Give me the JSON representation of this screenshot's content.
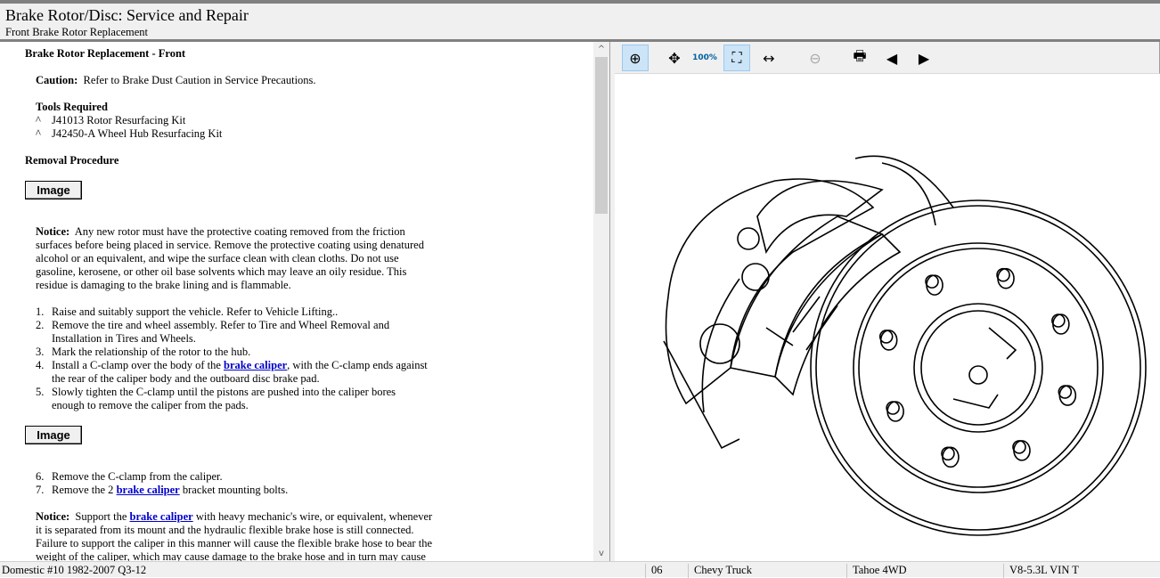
{
  "header": {
    "title": "Brake Rotor/Disc:  Service and Repair",
    "subtitle": "Front Brake Rotor Replacement"
  },
  "doc": {
    "heading": "Brake Rotor Replacement - Front",
    "caution_label": "Caution:",
    "caution_text": "Refer to Brake Dust Caution in Service Precautions.",
    "tools_heading": "Tools Required",
    "tools": [
      "J41013 Rotor Resurfacing Kit",
      "J42450-A Wheel Hub Resurfacing Kit"
    ],
    "tool_bullet": "^",
    "removal_heading": "Removal Procedure",
    "image_button": "Image",
    "notice1_label": "Notice:",
    "notice1_lines": [
      "Any new rotor must have the protective coating removed from the friction",
      "surfaces before being placed in service. Remove the protective coating using denatured",
      "alcohol or an equivalent, and wipe the surface clean with clean cloths. Do not use",
      "gasoline, kerosene, or other oil base solvents which may leave an oily residue. This",
      "residue is damaging to the brake lining and is flammable."
    ],
    "steps": [
      {
        "n": "1.",
        "lines": [
          "Raise and suitably support the vehicle. Refer to Vehicle Lifting.."
        ]
      },
      {
        "n": "2.",
        "lines": [
          "Remove the tire and wheel assembly. Refer to Tire and Wheel Removal and",
          "Installation in Tires and Wheels."
        ]
      },
      {
        "n": "3.",
        "lines": [
          "Mark the relationship of the rotor to the hub."
        ]
      },
      {
        "n": "4.",
        "pre": "Install a C-clamp over the body of the ",
        "link": "brake caliper",
        "post": ", with the C-clamp ends against",
        "lines": [
          "the rear of the caliper body and the outboard disc brake pad."
        ]
      },
      {
        "n": "5.",
        "lines": [
          "Slowly tighten the C-clamp until the pistons are pushed into the caliper bores",
          "enough to remove the caliper from the pads."
        ]
      },
      {
        "n": "6.",
        "lines": [
          "Remove the C-clamp from the caliper."
        ]
      },
      {
        "n": "7.",
        "pre": "Remove the 2 ",
        "link": "brake caliper",
        "post": " bracket mounting bolts."
      }
    ],
    "notice2_label": "Notice:",
    "notice2_pre": "Support the ",
    "notice2_link": "brake caliper",
    "notice2_post": " with heavy mechanic's wire, or equivalent, whenever",
    "notice2_lines": [
      "it is separated from its mount and the hydraulic flexible brake hose is still connected.",
      "Failure to support the caliper in this manner will cause the flexible brake hose to bear the",
      "weight of the caliper, which may cause damage to the brake hose and in turn may cause"
    ]
  },
  "toolbar": [
    {
      "name": "zoom-in",
      "icon": "zoom-in-icon",
      "glyph": "⊕",
      "active": true
    },
    {
      "name": "pan",
      "icon": "pan-icon",
      "glyph": "✥"
    },
    {
      "name": "zoom-100",
      "icon": "zoom-100-icon",
      "glyph": "100%"
    },
    {
      "name": "zoom-fit",
      "icon": "zoom-fit-icon",
      "glyph": "⛶",
      "active": true
    },
    {
      "name": "zoom-width",
      "icon": "zoom-width-icon",
      "glyph": "↔"
    },
    {
      "name": "zoom-out",
      "icon": "zoom-out-icon",
      "glyph": "⊖",
      "disabled": true
    },
    {
      "name": "print",
      "icon": "printer-icon",
      "glyph": "🖶"
    },
    {
      "name": "prev-image",
      "icon": "camera-prev-icon",
      "glyph": "◀"
    },
    {
      "name": "next-image",
      "icon": "camera-next-icon",
      "glyph": "▶"
    }
  ],
  "status": [
    "Domestic #10 1982-2007 Q3-12",
    "06",
    "Chevy Truck",
    "Tahoe 4WD",
    "V8-5.3L VIN T"
  ]
}
